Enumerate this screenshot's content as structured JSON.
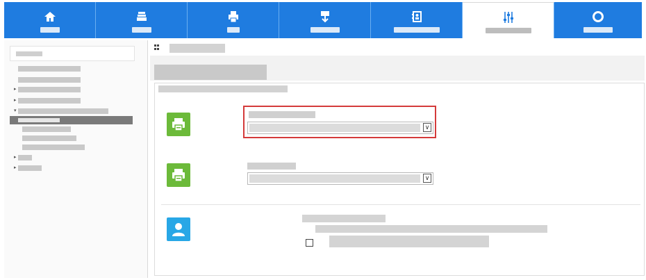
{
  "nav": {
    "tabs": [
      {
        "icon": "home-icon",
        "glyph": "⌂"
      },
      {
        "icon": "stack-icon",
        "glyph": "≣"
      },
      {
        "icon": "print-icon",
        "glyph": "⎙"
      },
      {
        "icon": "download-icon",
        "glyph": "⇩"
      },
      {
        "icon": "address-book-icon",
        "glyph": "☰"
      },
      {
        "icon": "sliders-icon",
        "glyph": "⫶"
      },
      {
        "icon": "lifebuoy-icon",
        "glyph": "◎"
      }
    ],
    "active_index": 5
  },
  "colors": {
    "nav_blue": "#1f7ce0",
    "highlight_red": "#d43a3a",
    "printer_green": "#6cba3a",
    "user_blue": "#28a7e6"
  },
  "main": {
    "breadcrumb_icon": "grid-icon",
    "sections": [
      {
        "icon": "printer-icon",
        "has_highlight": true
      },
      {
        "icon": "printer-icon",
        "has_highlight": false
      },
      {
        "icon": "user-icon",
        "has_checkbox": true
      }
    ]
  }
}
